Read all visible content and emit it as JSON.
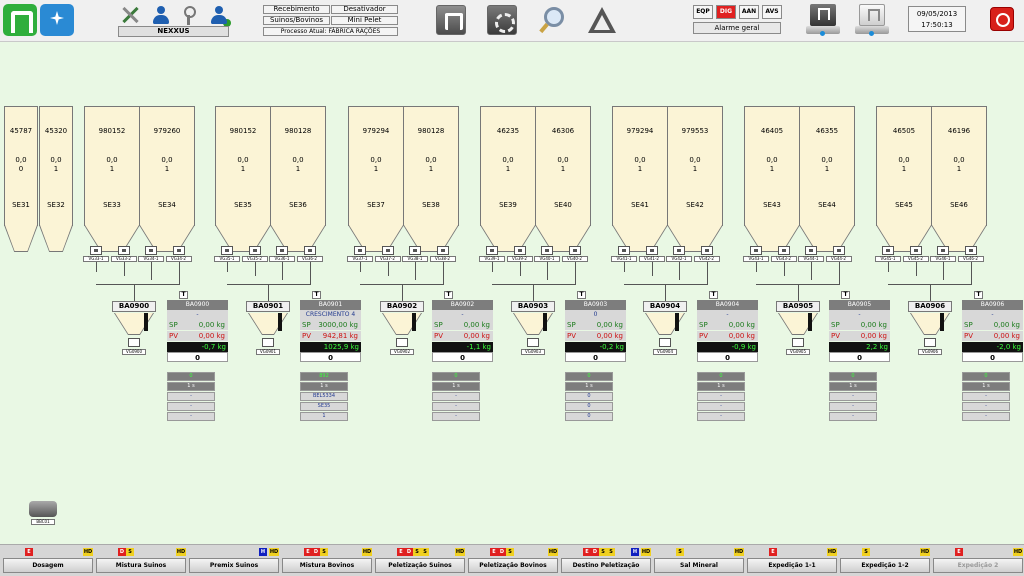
{
  "header": {
    "system_name": "NEXXUS",
    "recebimento": "Recebimento",
    "desativador": "Desativador",
    "suinos_bovinos": "Suinos/Bovinos",
    "mini_pelet": "Mini Pelet",
    "processo_atual": "Processo Atual:  FÁBRICA RAÇÕES",
    "alarm_tabs": [
      "EQP",
      "DIG",
      "AAN",
      "AVS"
    ],
    "alarm_tab_active": "DIG",
    "alarme_geral": "Alarme geral",
    "date": "09/05/2013",
    "time": "17:50:13"
  },
  "silos": [
    {
      "value": "45787",
      "a": "0,0",
      "b": "0",
      "name": "SE31"
    },
    {
      "value": "45320",
      "a": "0,0",
      "b": "1",
      "name": "SE32"
    },
    {
      "value": "980152",
      "a": "0,0",
      "b": "1",
      "name": "SE33"
    },
    {
      "value": "979260",
      "a": "0,0",
      "b": "1",
      "name": "SE34"
    },
    {
      "value": "980152",
      "a": "0,0",
      "b": "1",
      "name": "SE35"
    },
    {
      "value": "980128",
      "a": "0,0",
      "b": "1",
      "name": "SE36"
    },
    {
      "value": "979294",
      "a": "0,0",
      "b": "1",
      "name": "SE37"
    },
    {
      "value": "980128",
      "a": "0,0",
      "b": "1",
      "name": "SE38"
    },
    {
      "value": "46235",
      "a": "0,0",
      "b": "1",
      "name": "SE39"
    },
    {
      "value": "46306",
      "a": "0,0",
      "b": "1",
      "name": "SE40"
    },
    {
      "value": "979294",
      "a": "0,0",
      "b": "1",
      "name": "SE41"
    },
    {
      "value": "979553",
      "a": "0,0",
      "b": "1",
      "name": "SE42"
    },
    {
      "value": "46405",
      "a": "0,0",
      "b": "1",
      "name": "SE43"
    },
    {
      "value": "46355",
      "a": "0,0",
      "b": "1",
      "name": "SE44"
    },
    {
      "value": "46505",
      "a": "0,0",
      "b": "1",
      "name": "SE45"
    },
    {
      "value": "46196",
      "a": "0,0",
      "b": "1",
      "name": "SE46"
    }
  ],
  "valves": [
    [
      "VG33-1",
      "VG33-2",
      "VG34-1",
      "VG34-2"
    ],
    [
      "VG35-1",
      "VG35-2",
      "VG36-1",
      "VG36-2"
    ],
    [
      "VG37-1",
      "VG37-2",
      "VG38-1",
      "VG38-2"
    ],
    [
      "VG39-1",
      "VG39-2",
      "VG40-1",
      "VG40-2"
    ],
    [
      "VG41-1",
      "VG41-2",
      "VG42-1",
      "VG42-2"
    ],
    [
      "VG43-1",
      "VG43-2",
      "VG44-1",
      "VG44-2"
    ],
    [
      "VG45-1",
      "VG45-2",
      "VG46-1",
      "VG46-2"
    ]
  ],
  "balances": [
    {
      "name": "BA0900",
      "gate": "VG0900",
      "panel_title": "BA0900",
      "line1": "-",
      "sp": "0,00 kg",
      "pv": "0,00 kg",
      "weight": "-0,7 kg",
      "count": "0",
      "stack": [
        "0",
        "1 s",
        "-",
        "-",
        "-"
      ]
    },
    {
      "name": "BA0901",
      "gate": "VG0901",
      "panel_title": "BA0901",
      "line1": "CRESCIMENTO 4",
      "sp": "3000,00 kg",
      "pv": "942,81 kg",
      "weight": "1025,9 kg",
      "count": "0",
      "stack": [
        "892",
        "1 s",
        "BEL5334",
        "SE35",
        "1"
      ]
    },
    {
      "name": "BA0902",
      "gate": "VG0902",
      "panel_title": "BA0902",
      "line1": "-",
      "sp": "0,00 kg",
      "pv": "0,00 kg",
      "weight": "-1,1 kg",
      "count": "0",
      "stack": [
        "0",
        "1 s",
        "-",
        "-",
        "-"
      ]
    },
    {
      "name": "BA0903",
      "gate": "VG0903",
      "panel_title": "BA0903",
      "line1": "0",
      "sp": "0,00 kg",
      "pv": "0,00 kg",
      "weight": "-0,2 kg",
      "count": "0",
      "stack": [
        "0",
        "1 s",
        "0",
        "0",
        "0"
      ]
    },
    {
      "name": "BA0904",
      "gate": "VG0904",
      "panel_title": "BA0904",
      "line1": "-",
      "sp": "0,00 kg",
      "pv": "0,00 kg",
      "weight": "-0,9 kg",
      "count": "0",
      "stack": [
        "0",
        "1 s",
        "-",
        "-",
        "-"
      ]
    },
    {
      "name": "BA0905",
      "gate": "VG0905",
      "panel_title": "BA0905",
      "line1": "-",
      "sp": "0,00 kg",
      "pv": "0,00 kg",
      "weight": "2,2 kg",
      "count": "0",
      "stack": [
        "0",
        "1 s",
        "-",
        "-",
        "-"
      ]
    },
    {
      "name": "BA0906",
      "gate": "VG0906",
      "panel_title": "BA0906",
      "line1": "-",
      "sp": "0,00 kg",
      "pv": "0,00 kg",
      "weight": "-2,0 kg",
      "count": "0",
      "stack": [
        "0",
        "1 s",
        "-",
        "-",
        "-"
      ]
    }
  ],
  "labels": {
    "sp": "SP",
    "pv": "PV",
    "t": "T"
  },
  "motor": {
    "label": "BBC01"
  },
  "bottom_buttons": [
    {
      "label": "Dosagem",
      "flags": [
        "E",
        "HD"
      ]
    },
    {
      "label": "Mistura Suinos",
      "flags": [
        "D",
        "S",
        "HD"
      ]
    },
    {
      "label": "Premix Suinos",
      "flags": [
        "H",
        "HD"
      ]
    },
    {
      "label": "Mistura Bovinos",
      "flags": [
        "E",
        "D",
        "S",
        "HD"
      ]
    },
    {
      "label": "Peletização Suinos",
      "flags": [
        "E",
        "D",
        "S",
        "S",
        "HD"
      ]
    },
    {
      "label": "Peletização Bovinos",
      "flags": [
        "E",
        "D",
        "S",
        "HD"
      ]
    },
    {
      "label": "Destino Peletização",
      "flags": [
        "E",
        "D",
        "S",
        "S",
        "H",
        "HD"
      ]
    },
    {
      "label": "Sal Mineral",
      "flags": [
        "S",
        "HD"
      ]
    },
    {
      "label": "Expedição 1-1",
      "flags": [
        "E",
        "HD"
      ]
    },
    {
      "label": "Expedição 1-2",
      "flags": [
        "S",
        "HD"
      ]
    },
    {
      "label": "Expedição 2",
      "flags": [
        "E",
        "HD"
      ],
      "disabled": true
    }
  ]
}
